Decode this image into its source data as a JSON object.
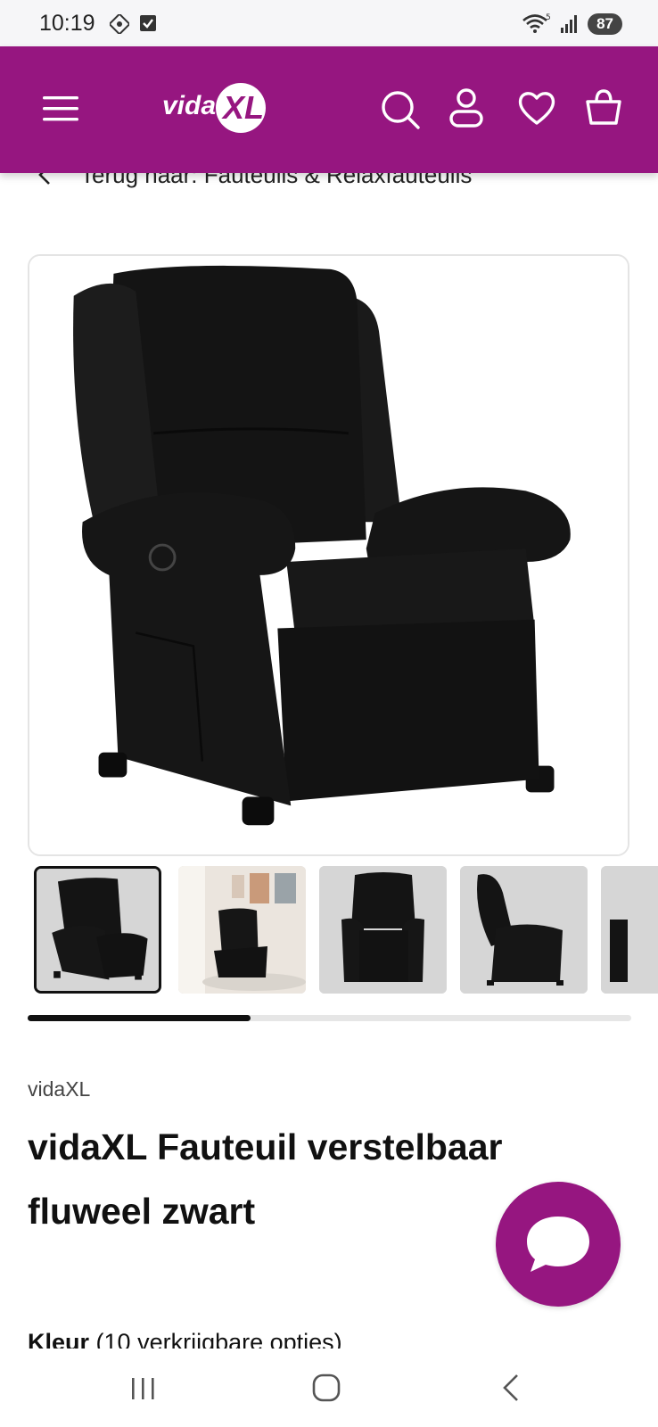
{
  "status_bar": {
    "time": "10:19",
    "battery": "87",
    "icons": [
      "nfc-icon",
      "checkbox-icon",
      "wifi-icon",
      "signal-icon",
      "battery-icon"
    ]
  },
  "header": {
    "logo_text": "vidaXL",
    "background_color": "#961680",
    "icons": [
      "menu-icon",
      "search-icon",
      "account-icon",
      "wishlist-icon",
      "cart-icon"
    ]
  },
  "breadcrumb": {
    "text": "Terug naar: Fauteuils & Relaxfauteuils"
  },
  "gallery": {
    "thumbnail_count_visible": 5,
    "active_index": 0,
    "scroll_progress": 0.37
  },
  "product": {
    "brand": "vidaXL",
    "title": "vidaXL Fauteuil verstelbaar fluweel zwart",
    "colour_label": "Kleur",
    "colour_options": "(10 verkrijgbare opties)"
  },
  "chat": {
    "icon": "chat-bubble-icon"
  },
  "nav_bar": {
    "icons": [
      "recent-apps-icon",
      "home-icon",
      "back-icon"
    ]
  }
}
